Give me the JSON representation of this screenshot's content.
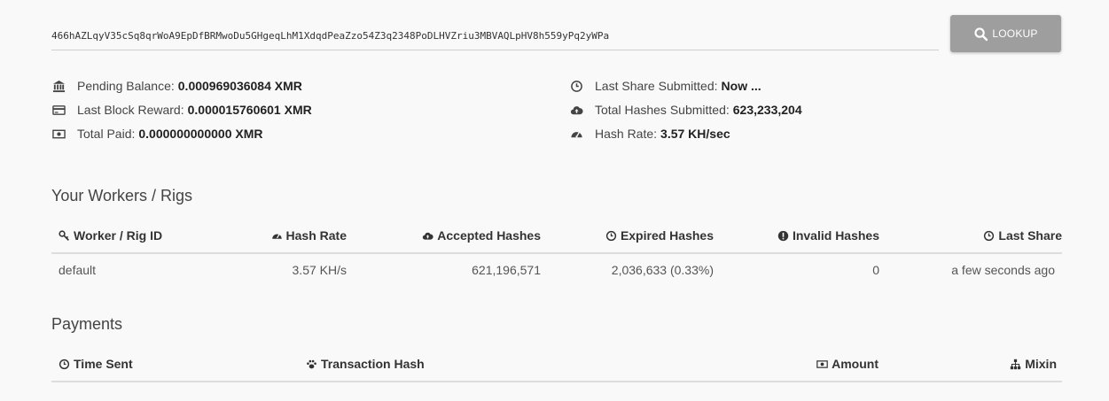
{
  "lookup": {
    "address_value": "466hAZLqyV35cSq8qrWoA9EpDfBRMwoDu5GHgeqLhM1XdqdPeaZzo54Z3q2348PoDLHVZriu3MBVAQLpHV8h559yPq2yWPa",
    "button_label": "LOOKUP"
  },
  "stats": {
    "left": [
      {
        "label": "Pending Balance:",
        "value": "0.000969036084 XMR",
        "icon": "bank-icon"
      },
      {
        "label": "Last Block Reward:",
        "value": "0.000015760601 XMR",
        "icon": "credit-card-icon"
      },
      {
        "label": "Total Paid:",
        "value": "0.000000000000 XMR",
        "icon": "money-icon"
      }
    ],
    "right": [
      {
        "label": "Last Share Submitted:",
        "value": "Now ...",
        "icon": "clock-icon"
      },
      {
        "label": "Total Hashes Submitted:",
        "value": "623,233,204",
        "icon": "cloud-upload-icon"
      },
      {
        "label": "Hash Rate:",
        "value": "3.57 KH/sec",
        "icon": "dashboard-icon"
      }
    ]
  },
  "workers": {
    "title": "Your Workers / Rigs",
    "headers": {
      "worker": "Worker / Rig ID",
      "hash_rate": "Hash Rate",
      "accepted": "Accepted Hashes",
      "expired": "Expired Hashes",
      "invalid": "Invalid Hashes",
      "last_share": "Last Share"
    },
    "rows": [
      {
        "worker": "default",
        "hash_rate": "3.57 KH/s",
        "accepted": "621,196,571",
        "expired": "2,036,633 (0.33%)",
        "invalid": "0",
        "last_share": "a few seconds ago"
      }
    ]
  },
  "payments": {
    "title": "Payments",
    "headers": {
      "time_sent": "Time Sent",
      "tx_hash": "Transaction Hash",
      "amount": "Amount",
      "mixin": "Mixin"
    }
  }
}
